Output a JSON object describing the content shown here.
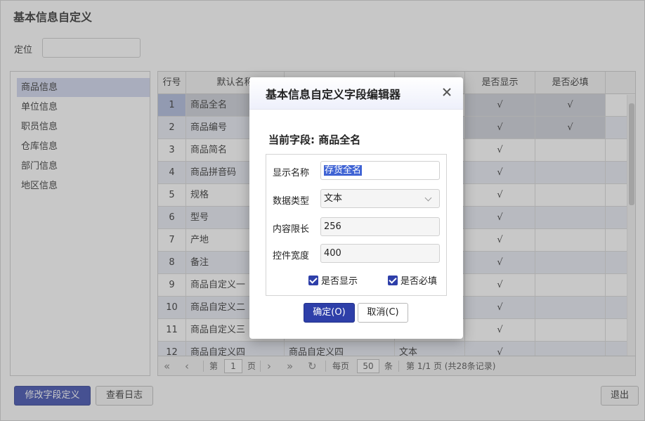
{
  "window": {
    "title": "基本信息自定义",
    "locate_label": "定位",
    "locate_value": ""
  },
  "left_list": [
    "商品信息",
    "单位信息",
    "职员信息",
    "仓库信息",
    "部门信息",
    "地区信息"
  ],
  "grid": {
    "headers": {
      "no": "行号",
      "name": "默认名称",
      "show": "是否显示",
      "required": "是否必填"
    },
    "rows": [
      {
        "no": "1",
        "name": "商品全名",
        "disp": "",
        "type": "",
        "show": "√",
        "req": "√"
      },
      {
        "no": "2",
        "name": "商品编号",
        "disp": "",
        "type": "",
        "show": "√",
        "req": "√"
      },
      {
        "no": "3",
        "name": "商品简名",
        "disp": "",
        "type": "",
        "show": "√",
        "req": ""
      },
      {
        "no": "4",
        "name": "商品拼音码",
        "disp": "",
        "type": "",
        "show": "√",
        "req": ""
      },
      {
        "no": "5",
        "name": "规格",
        "disp": "",
        "type": "",
        "show": "√",
        "req": ""
      },
      {
        "no": "6",
        "name": "型号",
        "disp": "",
        "type": "",
        "show": "√",
        "req": ""
      },
      {
        "no": "7",
        "name": "产地",
        "disp": "",
        "type": "",
        "show": "√",
        "req": ""
      },
      {
        "no": "8",
        "name": "备注",
        "disp": "",
        "type": "",
        "show": "√",
        "req": ""
      },
      {
        "no": "9",
        "name": "商品自定义一",
        "disp": "",
        "type": "",
        "show": "√",
        "req": ""
      },
      {
        "no": "10",
        "name": "商品自定义二",
        "disp": "",
        "type": "",
        "show": "√",
        "req": ""
      },
      {
        "no": "11",
        "name": "商品自定义三",
        "disp": "",
        "type": "",
        "show": "√",
        "req": ""
      },
      {
        "no": "12",
        "name": "商品自定义四",
        "disp": "商品自定义四",
        "type": "文本",
        "show": "√",
        "req": ""
      }
    ]
  },
  "pager": {
    "page_prefix": "第",
    "page_value": "1",
    "page_suffix": "页",
    "per_prefix": "每页",
    "per_value": "50",
    "per_suffix": "条",
    "summary": "第 1/1 页 (共28条记录)"
  },
  "buttons": {
    "modify": "修改字段定义",
    "log": "查看日志",
    "exit": "退出"
  },
  "dialog": {
    "title": "基本信息自定义字段编辑器",
    "current_field_label": "当前字段:",
    "current_field_value": "商品全名",
    "display_name_label": "显示名称",
    "display_name_value": "存货全名",
    "data_type_label": "数据类型",
    "data_type_value": "文本",
    "length_label": "内容限长",
    "length_value": "256",
    "width_label": "控件宽度",
    "width_value": "400",
    "show_label": "是否显示",
    "show_checked": true,
    "required_label": "是否必填",
    "required_checked": true,
    "ok_label": "确定(O)",
    "cancel_label": "取消(C)"
  },
  "colors": {
    "primary": "#2e3fa9",
    "selected_row": "#a9b5da",
    "alt_row": "#e5e8f2"
  }
}
